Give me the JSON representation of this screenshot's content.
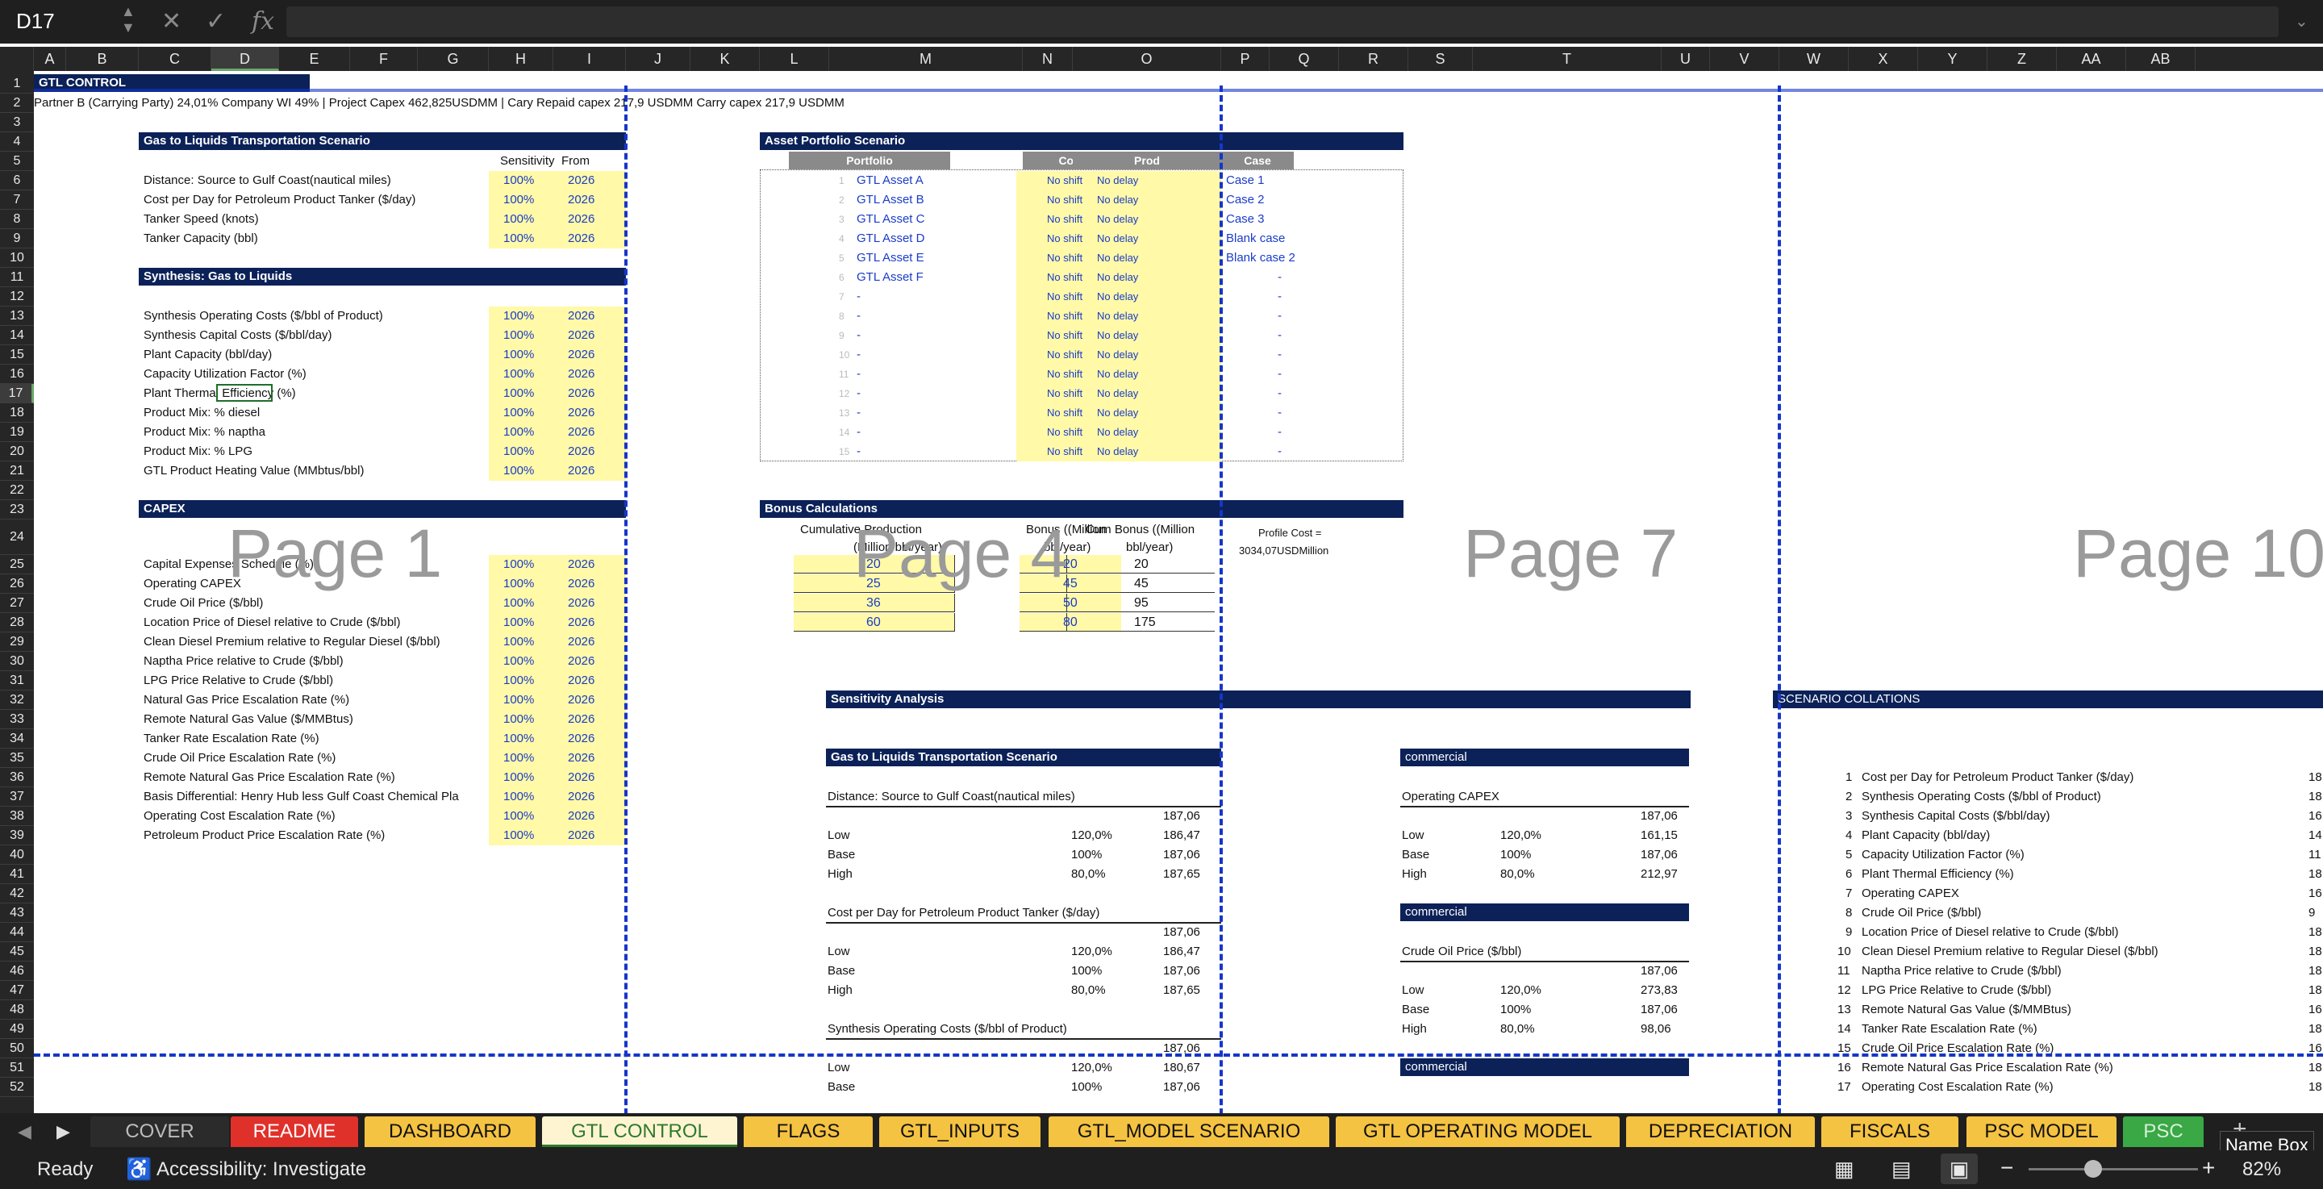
{
  "formula_bar": {
    "name_box": "D17",
    "formula": ""
  },
  "columns": [
    "A",
    "B",
    "C",
    "D",
    "E",
    "F",
    "G",
    "H",
    "I",
    "J",
    "K",
    "L",
    "M",
    "N",
    "O",
    "P",
    "Q",
    "R",
    "S",
    "T",
    "U",
    "V",
    "W",
    "X",
    "Y",
    "Z",
    "AA",
    "AB"
  ],
  "rows": [
    "1",
    "2",
    "3",
    "4",
    "5",
    "6",
    "7",
    "8",
    "9",
    "10",
    "11",
    "12",
    "13",
    "14",
    "15",
    "16",
    "17",
    "18",
    "19",
    "20",
    "21",
    "22",
    "23",
    "24",
    "25",
    "26",
    "27",
    "28",
    "29",
    "30",
    "31",
    "32",
    "33",
    "34",
    "35",
    "36",
    "37",
    "38",
    "39",
    "40",
    "41",
    "42",
    "43",
    "44",
    "45",
    "46",
    "47",
    "48",
    "49",
    "50",
    "51",
    "52"
  ],
  "sheet": {
    "title": "GTL CONTROL",
    "info_line": "Partner B (Carrying Party) 24,01% Company WI 49%  |  Project Capex  462,825USDMM  |  Cary Repaid capex 217,9  USDMM Carry capex 217,9  USDMM",
    "page_labels": [
      "Page 1",
      "Page 4",
      "Page 7",
      "Page 10"
    ],
    "left_sections": [
      {
        "title": "Gas to Liquids Transportation Scenario",
        "col_sens": "Sensitivity",
        "col_from": "From",
        "rows": [
          {
            "label": "Distance:  Source to Gulf Coast(nautical miles)",
            "sens": "100%",
            "from": "2026"
          },
          {
            "label": "Cost per Day for Petroleum Product Tanker ($/day)",
            "sens": "100%",
            "from": "2026"
          },
          {
            "label": "Tanker Speed (knots)",
            "sens": "100%",
            "from": "2026"
          },
          {
            "label": "Tanker Capacity (bbl)",
            "sens": "100%",
            "from": "2026"
          }
        ]
      },
      {
        "title": "Synthesis: Gas to Liquids",
        "rows": [
          {
            "label": "Synthesis Operating Costs ($/bbl of Product)",
            "sens": "100%",
            "from": "2026"
          },
          {
            "label": "Synthesis Capital Costs ($/bbl/day)",
            "sens": "100%",
            "from": "2026"
          },
          {
            "label": "Plant Capacity  (bbl/day)",
            "sens": "100%",
            "from": "2026"
          },
          {
            "label": "Capacity Utilization Factor (%)",
            "sens": "100%",
            "from": "2026"
          },
          {
            "label": "Plant Thermal Efficiency (%)",
            "sens": "100%",
            "from": "2026"
          },
          {
            "label": "Product Mix:  % diesel",
            "sens": "100%",
            "from": "2026"
          },
          {
            "label": "Product Mix:  % naptha",
            "sens": "100%",
            "from": "2026"
          },
          {
            "label": "Product Mix:  % LPG",
            "sens": "100%",
            "from": "2026"
          },
          {
            "label": "GTL Product Heating Value  (MMbtus/bbl)",
            "sens": "100%",
            "from": "2026"
          }
        ]
      },
      {
        "title": "CAPEX",
        "rows": [
          {
            "label": "  Capital Expenses Schedule (%)",
            "sens": "100%",
            "from": "2026"
          },
          {
            "label": "Operating CAPEX",
            "sens": "100%",
            "from": "2026"
          },
          {
            "label": "Crude Oil Price ($/bbl)",
            "sens": "100%",
            "from": "2026"
          },
          {
            "label": "Location Price of Diesel  relative to Crude ($/bbl)",
            "sens": "100%",
            "from": "2026"
          },
          {
            "label": "Clean Diesel Premium relative to Regular Diesel ($/bbl)",
            "sens": "100%",
            "from": "2026"
          },
          {
            "label": "Naptha Price relative to Crude ($/bbl)",
            "sens": "100%",
            "from": "2026"
          },
          {
            "label": "LPG Price Relative to Crude ($/bbl)",
            "sens": "100%",
            "from": "2026"
          },
          {
            "label": "Natural Gas Price Escalation Rate (%)",
            "sens": "100%",
            "from": "2026"
          },
          {
            "label": "Remote Natural Gas Value ($/MMBtus)",
            "sens": "100%",
            "from": "2026"
          },
          {
            "label": "Tanker Rate Escalation Rate (%)",
            "sens": "100%",
            "from": "2026"
          },
          {
            "label": "Crude Oil Price Escalation Rate (%)",
            "sens": "100%",
            "from": "2026"
          },
          {
            "label": "Remote Natural Gas Price Escalation Rate (%)",
            "sens": "100%",
            "from": "2026"
          },
          {
            "label": "Basis Differential:  Henry Hub less Gulf Coast Chemical Pla",
            "sens": "100%",
            "from": "2026"
          },
          {
            "label": "Operating Cost Escalation Rate (%)",
            "sens": "100%",
            "from": "2026"
          },
          {
            "label": "Petroleum Product Price Escalation Rate (%)",
            "sens": "100%",
            "from": "2026"
          }
        ]
      }
    ],
    "asset_portfolio": {
      "title": "Asset Portfolio Scenario",
      "headers": [
        "Portfolio",
        "Cost",
        "Prod",
        "Case"
      ],
      "rows": [
        {
          "n": "1",
          "name": "GTL Asset A",
          "cost": "No shift",
          "prod": "No delay",
          "case": "Case 1"
        },
        {
          "n": "2",
          "name": "GTL Asset B",
          "cost": "No shift",
          "prod": "No delay",
          "case": "Case 2"
        },
        {
          "n": "3",
          "name": "GTL Asset C",
          "cost": "No shift",
          "prod": "No delay",
          "case": "Case 3"
        },
        {
          "n": "4",
          "name": "GTL Asset D",
          "cost": "No shift",
          "prod": "No delay",
          "case": "Blank case"
        },
        {
          "n": "5",
          "name": "GTL Asset E",
          "cost": "No shift",
          "prod": "No delay",
          "case": "Blank case 2"
        },
        {
          "n": "6",
          "name": "GTL Asset F",
          "cost": "No shift",
          "prod": "No delay",
          "case": "-"
        },
        {
          "n": "7",
          "name": "-",
          "cost": "No shift",
          "prod": "No delay",
          "case": "-"
        },
        {
          "n": "8",
          "name": "-",
          "cost": "No shift",
          "prod": "No delay",
          "case": "-"
        },
        {
          "n": "9",
          "name": "-",
          "cost": "No shift",
          "prod": "No delay",
          "case": "-"
        },
        {
          "n": "10",
          "name": "-",
          "cost": "No shift",
          "prod": "No delay",
          "case": "-"
        },
        {
          "n": "11",
          "name": "-",
          "cost": "No shift",
          "prod": "No delay",
          "case": "-"
        },
        {
          "n": "12",
          "name": "-",
          "cost": "No shift",
          "prod": "No delay",
          "case": "-"
        },
        {
          "n": "13",
          "name": "-",
          "cost": "No shift",
          "prod": "No delay",
          "case": "-"
        },
        {
          "n": "14",
          "name": "-",
          "cost": "No shift",
          "prod": "No delay",
          "case": "-"
        },
        {
          "n": "15",
          "name": "-",
          "cost": "No shift",
          "prod": "No delay",
          "case": "-"
        }
      ]
    },
    "bonus": {
      "title": "Bonus Calculations",
      "h1a": "Cumulative Production",
      "h1b": "(Million bbl/year)",
      "h2a": "Bonus ((Million",
      "h2b": "bbl/year)",
      "h3a": "Cum Bonus ((Million",
      "h3b": "bbl/year)",
      "profile_a": "Profile Cost =",
      "profile_b": "3034,07USDMillion",
      "rows": [
        {
          "cum": "20",
          "bonus": "20",
          "cumb": "20"
        },
        {
          "cum": "25",
          "bonus": "45",
          "cumb": "45"
        },
        {
          "cum": "36",
          "bonus": "50",
          "cumb": "95"
        },
        {
          "cum": "60",
          "bonus": "80",
          "cumb": "175"
        }
      ]
    },
    "sensitivity": {
      "title": "Sensitivity Analysis",
      "left_header": "Gas to Liquids Transportation Scenario",
      "blocks_left": [
        {
          "title": "Distance:  Source to Gulf Coast(nautical miles)",
          "base": "187,06",
          "rows": [
            {
              "k": "Low",
              "p": "120,0%",
              "v": "186,47"
            },
            {
              "k": "Base",
              "p": "100%",
              "v": "187,06"
            },
            {
              "k": "High",
              "p": "80,0%",
              "v": "187,65"
            }
          ]
        },
        {
          "title": "Cost per Day for Petroleum Product Tanker ($/day)",
          "base": "187,06",
          "rows": [
            {
              "k": "Low",
              "p": "120,0%",
              "v": "186,47"
            },
            {
              "k": "Base",
              "p": "100%",
              "v": "187,06"
            },
            {
              "k": "High",
              "p": "80,0%",
              "v": "187,65"
            }
          ]
        },
        {
          "title": "Synthesis Operating Costs ($/bbl of Product)",
          "base": "187,06",
          "rows": [
            {
              "k": "Low",
              "p": "120,0%",
              "v": "180,67"
            },
            {
              "k": "Base",
              "p": "100%",
              "v": "187,06"
            }
          ]
        }
      ],
      "blocks_right": [
        {
          "header": "commercial",
          "title": "Operating CAPEX",
          "base": "187,06",
          "rows": [
            {
              "k": "Low",
              "p": "120,0%",
              "v": "161,15"
            },
            {
              "k": "Base",
              "p": "100%",
              "v": "187,06"
            },
            {
              "k": "High",
              "p": "80,0%",
              "v": "212,97"
            }
          ]
        },
        {
          "header": "commercial",
          "title": "Crude Oil Price ($/bbl)",
          "base": "187,06",
          "rows": [
            {
              "k": "Low",
              "p": "120,0%",
              "v": "273,83"
            },
            {
              "k": "Base",
              "p": "100%",
              "v": "187,06"
            },
            {
              "k": "High",
              "p": "80,0%",
              "v": "98,06"
            }
          ]
        },
        {
          "header": "commercial"
        }
      ]
    },
    "collations": {
      "title": "SCENARIO COLLATIONS",
      "items": [
        {
          "n": "1",
          "label": "Cost per Day for Petroleum Product Tanker ($/day)",
          "v": "18"
        },
        {
          "n": "2",
          "label": "Synthesis Operating Costs ($/bbl of Product)",
          "v": "18"
        },
        {
          "n": "3",
          "label": "Synthesis Capital Costs ($/bbl/day)",
          "v": "16"
        },
        {
          "n": "4",
          "label": "Plant Capacity  (bbl/day)",
          "v": "14"
        },
        {
          "n": "5",
          "label": "Capacity Utilization Factor (%)",
          "v": "11"
        },
        {
          "n": "6",
          "label": "Plant Thermal Efficiency (%)",
          "v": "18"
        },
        {
          "n": "7",
          "label": "Operating CAPEX",
          "v": "16"
        },
        {
          "n": "8",
          "label": "Crude Oil Price ($/bbl)",
          "v": "9"
        },
        {
          "n": "9",
          "label": "Location Price of Diesel  relative to Crude ($/bbl)",
          "v": "18"
        },
        {
          "n": "10",
          "label": "Clean Diesel Premium relative to Regular Diesel ($/bbl)",
          "v": "18"
        },
        {
          "n": "11",
          "label": "Naptha Price relative to Crude ($/bbl)",
          "v": "18"
        },
        {
          "n": "12",
          "label": "LPG Price Relative to Crude ($/bbl)",
          "v": "18"
        },
        {
          "n": "13",
          "label": "Remote Natural Gas Value ($/MMBtus)",
          "v": "16"
        },
        {
          "n": "14",
          "label": "Tanker Rate Escalation Rate (%)",
          "v": "18"
        },
        {
          "n": "15",
          "label": "Crude Oil Price Escalation Rate (%)",
          "v": "16"
        },
        {
          "n": "16",
          "label": "Remote Natural Gas Price Escalation Rate (%)",
          "v": "18"
        },
        {
          "n": "17",
          "label": "Operating Cost Escalation Rate (%)",
          "v": "18"
        }
      ]
    }
  },
  "sheet_tabs": [
    {
      "label": "COVER",
      "color": "#2b2b2b",
      "text": "#bdbdbd"
    },
    {
      "label": "README",
      "color": "#e0302a",
      "text": "#ffffff"
    },
    {
      "label": "DASHBOARD",
      "color": "#f5c342",
      "text": "#111111"
    },
    {
      "label": "GTL CONTROL",
      "color": "#fff4d2",
      "text": "#2d7a2d"
    },
    {
      "label": "FLAGS",
      "color": "#f5c342",
      "text": "#111111"
    },
    {
      "label": "GTL_INPUTS",
      "color": "#f5c342",
      "text": "#111111"
    },
    {
      "label": "GTL_MODEL SCENARIO",
      "color": "#f5c342",
      "text": "#111111"
    },
    {
      "label": "GTL OPERATING MODEL",
      "color": "#f5c342",
      "text": "#111111"
    },
    {
      "label": "DEPRECIATION",
      "color": "#f5c342",
      "text": "#111111"
    },
    {
      "label": "FISCALS",
      "color": "#f5c342",
      "text": "#111111"
    },
    {
      "label": "PSC MODEL",
      "color": "#f5c342",
      "text": "#111111"
    },
    {
      "label": "PSC",
      "color": "#39a845",
      "text": "#d8f0d8"
    }
  ],
  "name_box_tooltip": "Name Box",
  "status": {
    "ready": "Ready",
    "accessibility": "Accessibility: Investigate",
    "zoom": "82%"
  }
}
